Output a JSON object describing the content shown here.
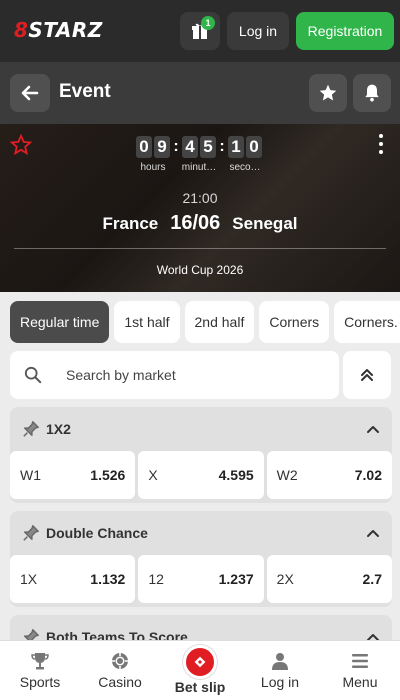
{
  "brand": {
    "logo_prefix": "8",
    "logo_text": "STARZ",
    "accent_color": "#e11d24",
    "green_color": "#2fb54a"
  },
  "header": {
    "gift_badge": "1",
    "login_label": "Log in",
    "registration_label": "Registration"
  },
  "event_bar": {
    "title": "Event"
  },
  "match": {
    "timer": {
      "hours": "09",
      "minutes": "45",
      "seconds": "10",
      "hours_label": "hours",
      "minutes_label": "minut…",
      "seconds_label": "seco…"
    },
    "time": "21:00",
    "home_team": "France",
    "score": "16/06",
    "away_team": "Senegal",
    "tournament": "World Cup 2026"
  },
  "tabs": [
    {
      "label": "Regular time",
      "active": true
    },
    {
      "label": "1st half"
    },
    {
      "label": "2nd half"
    },
    {
      "label": "Corners"
    },
    {
      "label": "Corners."
    }
  ],
  "search": {
    "placeholder": "Search by market"
  },
  "markets": [
    {
      "title": "1X2",
      "odds": [
        {
          "label": "W1",
          "value": "1.526"
        },
        {
          "label": "X",
          "value": "4.595"
        },
        {
          "label": "W2",
          "value": "7.02"
        }
      ]
    },
    {
      "title": "Double Chance",
      "odds": [
        {
          "label": "1X",
          "value": "1.132"
        },
        {
          "label": "12",
          "value": "1.237"
        },
        {
          "label": "2X",
          "value": "2.7"
        }
      ]
    },
    {
      "title": "Both Teams To Score"
    }
  ],
  "bottom_nav": [
    {
      "label": "Sports",
      "icon": "trophy-icon"
    },
    {
      "label": "Casino",
      "icon": "chip-icon"
    },
    {
      "label": "Bet slip",
      "icon": "ticket-icon"
    },
    {
      "label": "Log in",
      "icon": "user-icon"
    },
    {
      "label": "Menu",
      "icon": "menu-icon"
    }
  ]
}
